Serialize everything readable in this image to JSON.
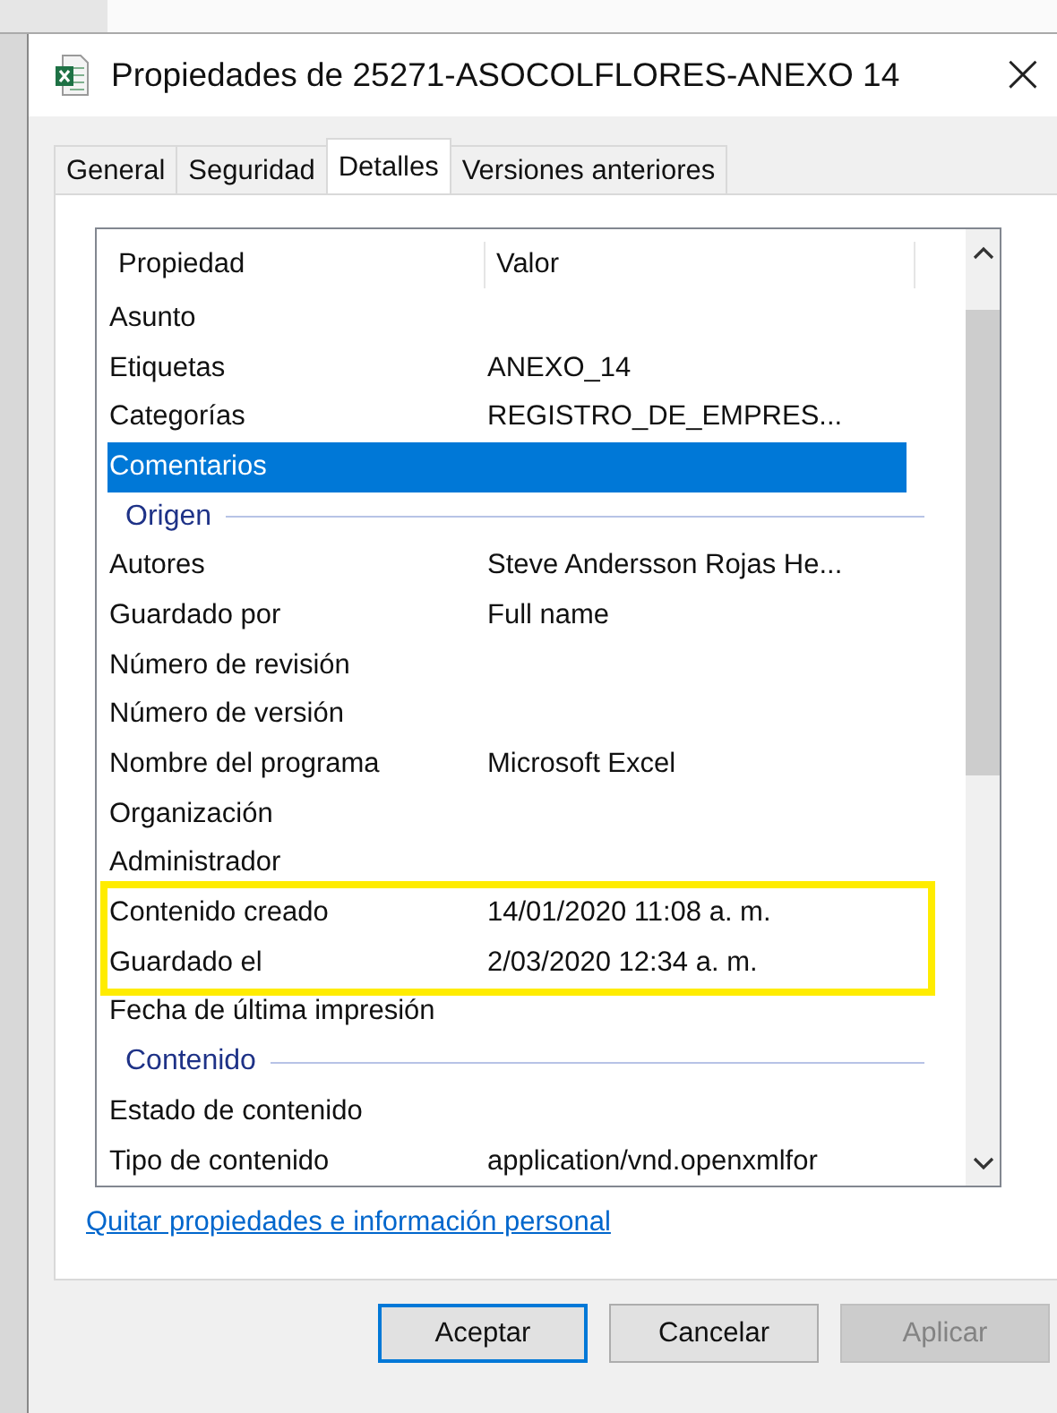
{
  "window": {
    "title": "Propiedades de 25271-ASOCOLFLORES-ANEXO 14",
    "close": "×"
  },
  "tabs": [
    {
      "label": "General",
      "selected": false
    },
    {
      "label": "Seguridad",
      "selected": false
    },
    {
      "label": "Detalles",
      "selected": true
    },
    {
      "label": "Versiones anteriores",
      "selected": false
    }
  ],
  "table": {
    "columns": [
      "Propiedad",
      "Valor"
    ],
    "rows": [
      {
        "kind": "row",
        "property": "Asunto",
        "value": "",
        "selected": false,
        "highlighted": false
      },
      {
        "kind": "row",
        "property": "Etiquetas",
        "value": "ANEXO_14",
        "selected": false,
        "highlighted": false
      },
      {
        "kind": "row",
        "property": "Categorías",
        "value": "REGISTRO_DE_EMPRES...",
        "selected": false,
        "highlighted": false
      },
      {
        "kind": "row",
        "property": "Comentarios",
        "value": "",
        "selected": true,
        "highlighted": false
      },
      {
        "kind": "group",
        "property": "Origen"
      },
      {
        "kind": "row",
        "property": "Autores",
        "value": "Steve Andersson Rojas He...",
        "selected": false,
        "highlighted": false
      },
      {
        "kind": "row",
        "property": "Guardado por",
        "value": "Full name",
        "selected": false,
        "highlighted": false
      },
      {
        "kind": "row",
        "property": "Número de revisión",
        "value": "",
        "selected": false,
        "highlighted": false
      },
      {
        "kind": "row",
        "property": "Número de versión",
        "value": "",
        "selected": false,
        "highlighted": false
      },
      {
        "kind": "row",
        "property": "Nombre del programa",
        "value": "Microsoft Excel",
        "selected": false,
        "highlighted": false
      },
      {
        "kind": "row",
        "property": "Organización",
        "value": "",
        "selected": false,
        "highlighted": false
      },
      {
        "kind": "row",
        "property": "Administrador",
        "value": "",
        "selected": false,
        "highlighted": false
      },
      {
        "kind": "row",
        "property": "Contenido creado",
        "value": "14/01/2020 11:08 a. m.",
        "selected": false,
        "highlighted": true
      },
      {
        "kind": "row",
        "property": "Guardado el",
        "value": "2/03/2020 12:34 a. m.",
        "selected": false,
        "highlighted": true
      },
      {
        "kind": "row",
        "property": "Fecha de última impresión",
        "value": "",
        "selected": false,
        "highlighted": false
      },
      {
        "kind": "group",
        "property": "Contenido"
      },
      {
        "kind": "row",
        "property": "Estado de contenido",
        "value": "",
        "selected": false,
        "highlighted": false
      },
      {
        "kind": "row",
        "property": "Tipo de contenido",
        "value": "application/vnd.openxmlfor",
        "selected": false,
        "highlighted": false
      }
    ]
  },
  "link": "Quitar propiedades e información personal",
  "buttons": [
    {
      "label": "Aceptar",
      "default": true,
      "disabled": false
    },
    {
      "label": "Cancelar",
      "default": false,
      "disabled": false
    },
    {
      "label": "Aplicar",
      "default": false,
      "disabled": true
    }
  ]
}
